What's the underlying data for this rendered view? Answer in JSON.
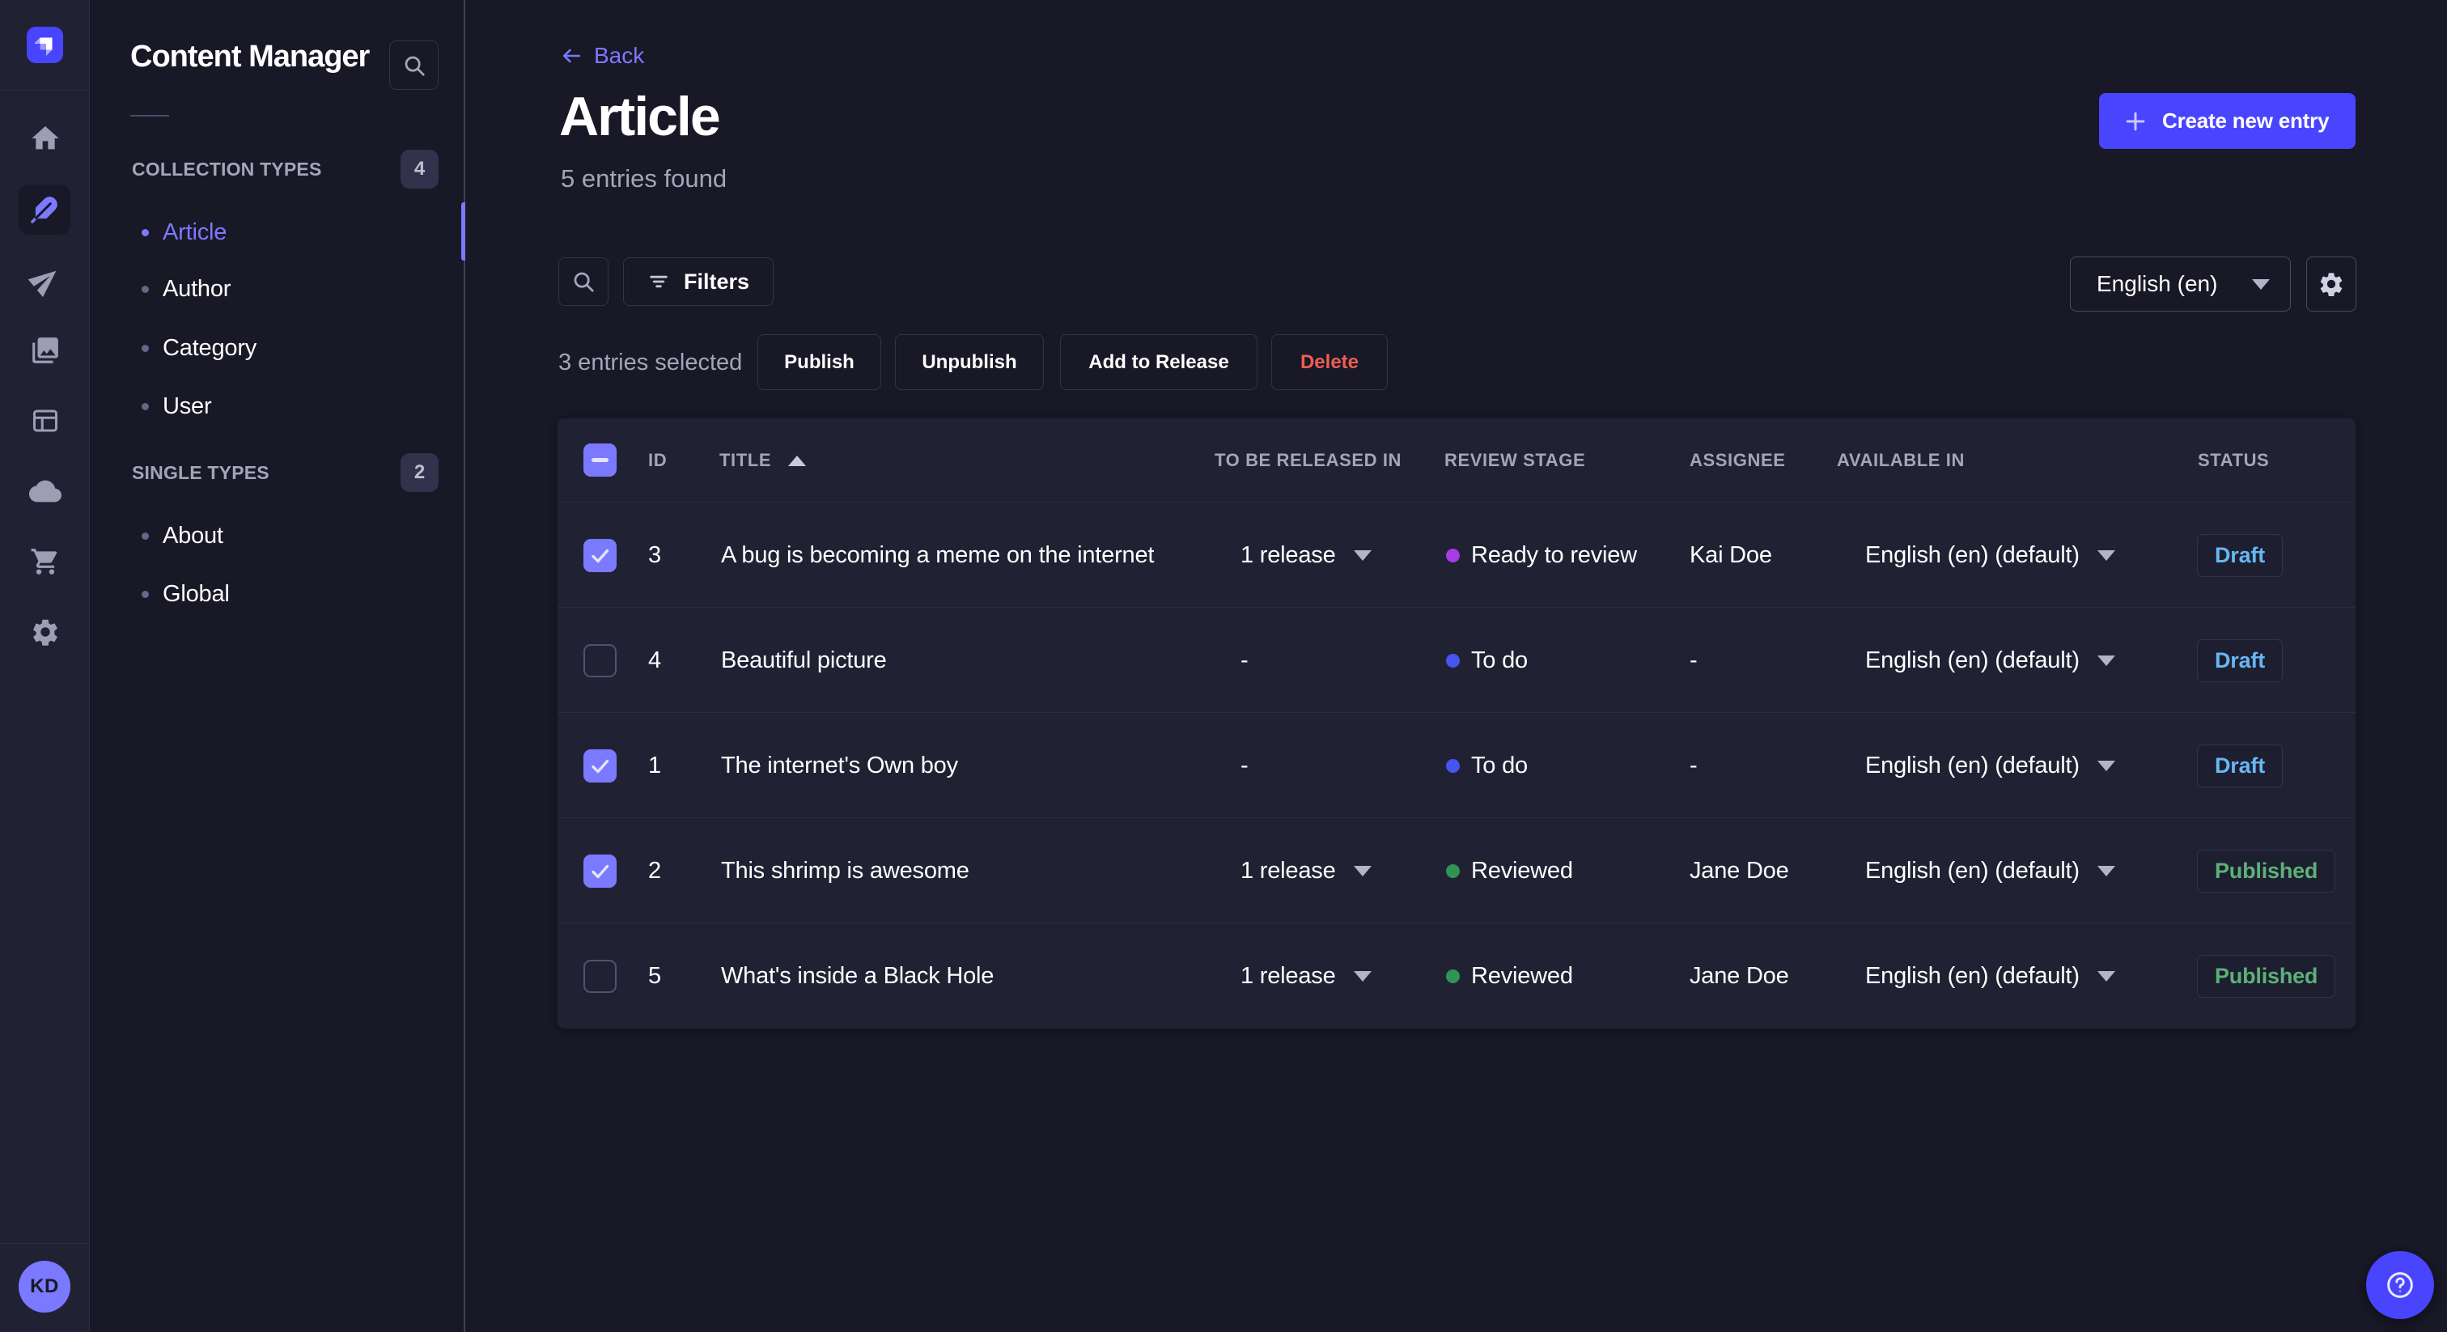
{
  "app": {
    "name": "Content Manager",
    "theme": "dark",
    "colors": {
      "background": "#181826",
      "surface": "#212134",
      "accent": "#7b79ff",
      "brand": "#4945ff",
      "danger": "#ee5e52",
      "draft": "#66b7f1",
      "published": "#5cb176"
    }
  },
  "rail": {
    "logo_icon": "strapi-logo",
    "icons": [
      "home-icon",
      "content-manager-feather-icon",
      "send-icon",
      "media-library-icon",
      "content-type-builder-icon",
      "cloud-icon",
      "marketplace-cart-icon",
      "settings-gear-icon"
    ],
    "active_icon": "content-manager-feather-icon",
    "avatar_initials": "KD"
  },
  "subnav": {
    "title": "Content Manager",
    "search_icon": "search-icon",
    "sections": [
      {
        "label": "COLLECTION TYPES",
        "badge": "4",
        "items": [
          {
            "label": "Article",
            "active": true
          },
          {
            "label": "Author",
            "active": false
          },
          {
            "label": "Category",
            "active": false
          },
          {
            "label": "User",
            "active": false
          }
        ]
      },
      {
        "label": "SINGLE TYPES",
        "badge": "2",
        "items": [
          {
            "label": "About",
            "active": false
          },
          {
            "label": "Global",
            "active": false
          }
        ]
      }
    ]
  },
  "header": {
    "back_label": "Back",
    "title": "Article",
    "subtitle": "5 entries found",
    "create_button_label": "Create new entry"
  },
  "toolbar": {
    "search_icon": "search-icon",
    "filters_label": "Filters",
    "locale_selected": "English (en)",
    "settings_icon": "gear-icon"
  },
  "selection": {
    "text": "3 entries selected",
    "publish_label": "Publish",
    "unpublish_label": "Unpublish",
    "add_to_release_label": "Add to Release",
    "delete_label": "Delete"
  },
  "table": {
    "columns": {
      "id": "ID",
      "title": "TITLE",
      "release": "TO BE RELEASED IN",
      "stage": "REVIEW STAGE",
      "assignee": "ASSIGNEE",
      "locale": "AVAILABLE IN",
      "status": "STATUS"
    },
    "sorted_column": "TITLE",
    "sort_direction": "ascending",
    "header_checkbox_state": "indeterminate",
    "rows": [
      {
        "checked": true,
        "id": "3",
        "title": "A bug is becoming a meme on the internet",
        "release": "1 release",
        "release_menu": true,
        "stage": "Ready to review",
        "stage_color": "#a53ce8",
        "assignee": "Kai Doe",
        "locale": "English (en) (default)",
        "status": "Draft"
      },
      {
        "checked": false,
        "id": "4",
        "title": "Beautiful picture",
        "release": "-",
        "release_menu": false,
        "stage": "To do",
        "stage_color": "#4655f0",
        "assignee": "-",
        "locale": "English (en) (default)",
        "status": "Draft"
      },
      {
        "checked": true,
        "id": "1",
        "title": "The internet's Own boy",
        "release": "-",
        "release_menu": false,
        "stage": "To do",
        "stage_color": "#4655f0",
        "assignee": "-",
        "locale": "English (en) (default)",
        "status": "Draft"
      },
      {
        "checked": true,
        "id": "2",
        "title": "This shrimp is awesome",
        "release": "1 release",
        "release_menu": true,
        "stage": "Reviewed",
        "stage_color": "#2f9552",
        "assignee": "Jane Doe",
        "locale": "English (en) (default)",
        "status": "Published"
      },
      {
        "checked": false,
        "id": "5",
        "title": "What's inside a Black Hole",
        "release": "1 release",
        "release_menu": true,
        "stage": "Reviewed",
        "stage_color": "#2f9552",
        "assignee": "Jane Doe",
        "locale": "English (en) (default)",
        "status": "Published"
      }
    ]
  },
  "help": {
    "icon": "question-mark-icon"
  }
}
